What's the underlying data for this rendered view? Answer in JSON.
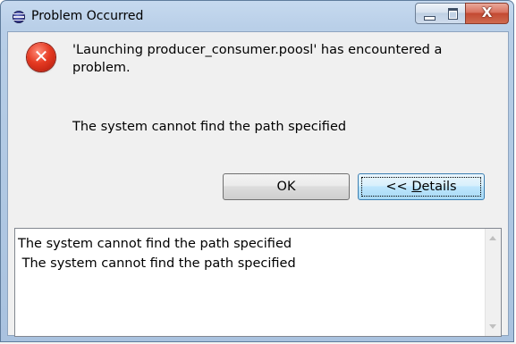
{
  "window": {
    "title": "Problem Occurred",
    "close_symbol": "X"
  },
  "dialog": {
    "message": "'Launching producer_consumer.poosl' has encountered a problem.",
    "detail": "The system cannot find the path specified",
    "icon": "error-icon"
  },
  "buttons": {
    "ok_label": "OK",
    "details_prefix": "<< ",
    "details_mnemonic": "D",
    "details_rest": "etails"
  },
  "details": {
    "lines": [
      "The system cannot find the path specified",
      " The system cannot find the path specified"
    ]
  }
}
